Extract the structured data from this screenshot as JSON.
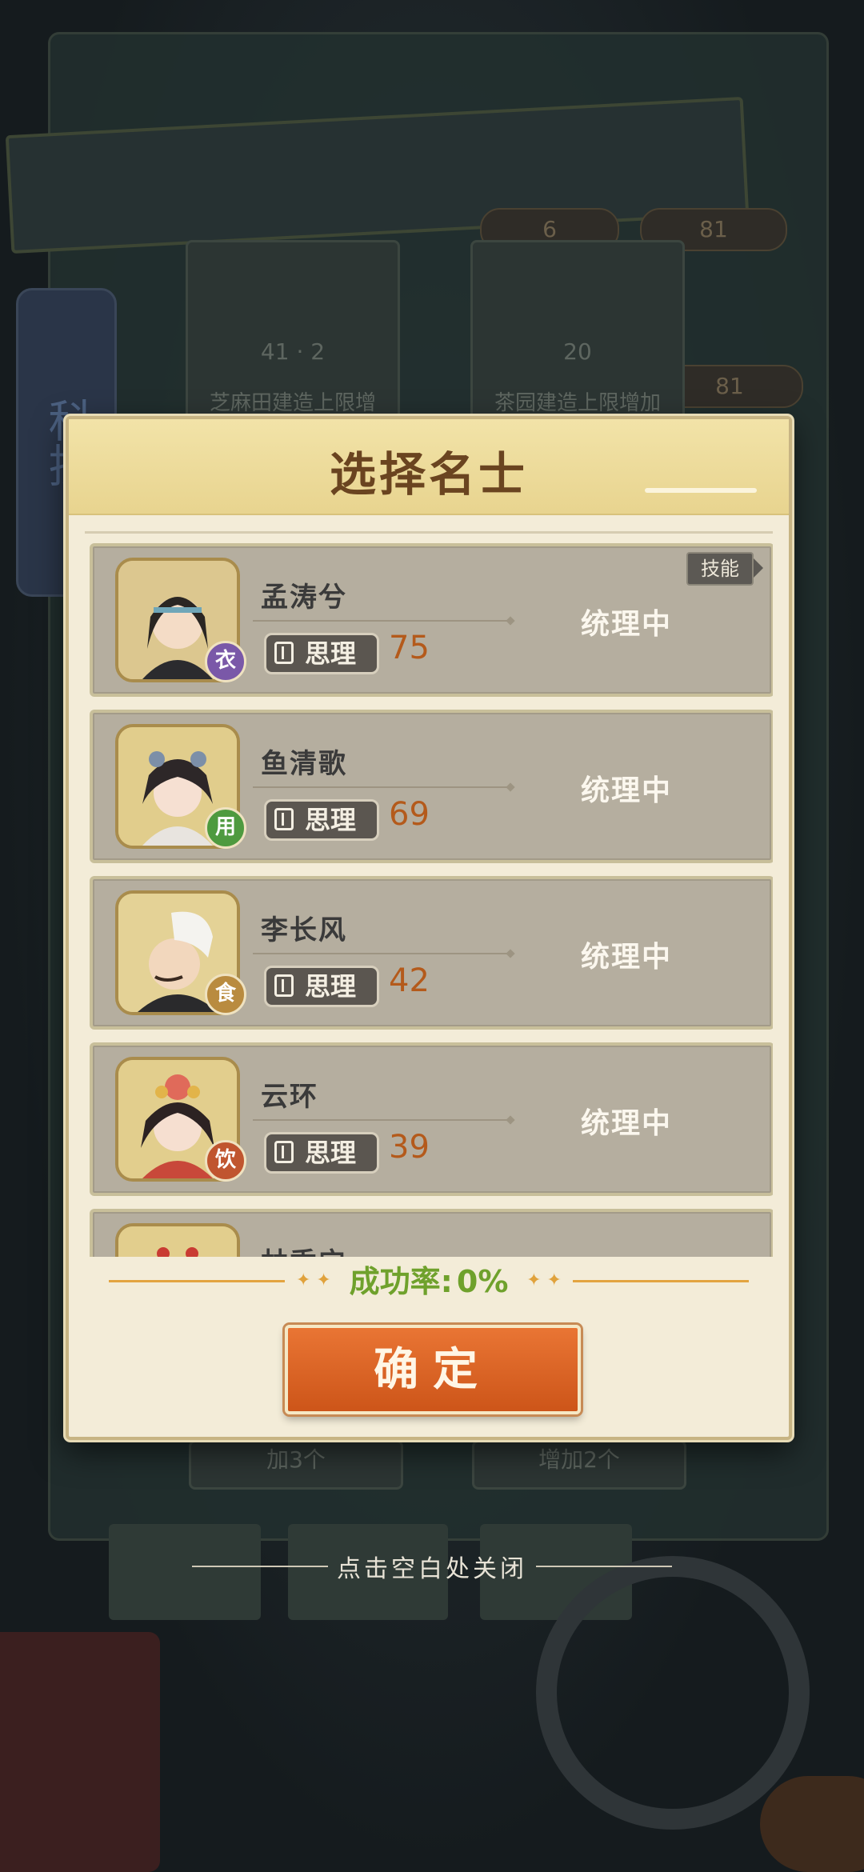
{
  "background": {
    "side_tab_label": "科技",
    "resource_top_1": "6",
    "resource_top_2": "81",
    "resource_right": "81",
    "card_1_cost_a": "41",
    "card_1_cost_b": "2",
    "card_1_desc": "芝麻田建造上限增",
    "card_2_cost": "20",
    "card_2_desc": "茶园建造上限增加",
    "card_3_desc": "加3个",
    "card_4_desc": "增加2个"
  },
  "modal": {
    "title": "选择名士",
    "skill_tag": "技能",
    "attr_label": "思理",
    "success_rate_label": "成功率:",
    "success_rate_value": "0%",
    "confirm_label": "确定",
    "close_hint": "点击空白处关闭"
  },
  "scholars": [
    {
      "name": "孟涛兮",
      "badge": "衣",
      "badge_color": "#7a58a8",
      "value": "75",
      "status": "统理中"
    },
    {
      "name": "鱼清歌",
      "badge": "用",
      "badge_color": "#4e9a3f",
      "value": "69",
      "status": "统理中"
    },
    {
      "name": "李长风",
      "badge": "食",
      "badge_color": "#b98b3f",
      "value": "42",
      "status": "统理中"
    },
    {
      "name": "云环",
      "badge": "饮",
      "badge_color": "#c0552f",
      "value": "39",
      "status": "统理中"
    },
    {
      "name": "林秀宁",
      "badge": "",
      "badge_color": "#9d7a44",
      "value": "",
      "status": ""
    }
  ],
  "colors": {
    "accent_orange": "#d45f20",
    "rate_green": "#6fa12c",
    "value_brown": "#b45a1b"
  }
}
